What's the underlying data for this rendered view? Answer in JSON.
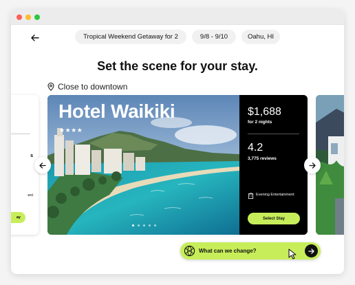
{
  "window": {
    "controls": [
      "close",
      "minimize",
      "maximize"
    ]
  },
  "header": {
    "back_icon": "arrow-left-icon",
    "trip_title": "Tropical Weekend Getaway for 2",
    "dates": "9/8 - 9/10",
    "location": "Oahu, HI"
  },
  "headline": "Set the scene for your stay.",
  "location_tag": {
    "icon": "map-pin-icon",
    "label": "Close to downtown"
  },
  "prev_card": {
    "line1": "s",
    "line2": "ent",
    "button": "ay"
  },
  "hotel": {
    "name": "Hotel Waikiki",
    "stars": "★★★★",
    "star_rating": 4,
    "price": "$1,688",
    "price_sub": "for 2 nights",
    "rating": "4.2",
    "reviews": "3,775 reviews",
    "amenity": "Evening Entertainment",
    "amenity_icon": "building-icon",
    "select_label": "Select Stay",
    "image_page": {
      "current": 1,
      "total": 5
    }
  },
  "carousel": {
    "prev_icon": "arrow-left-icon",
    "next_icon": "arrow-right-icon"
  },
  "prompt": {
    "text": "What can we change?",
    "icon": "globe-icon",
    "send_icon": "arrow-right-icon"
  },
  "colors": {
    "accent": "#c7ee5a",
    "card_dark": "#000000",
    "pill_bg": "#f1f1f1"
  }
}
